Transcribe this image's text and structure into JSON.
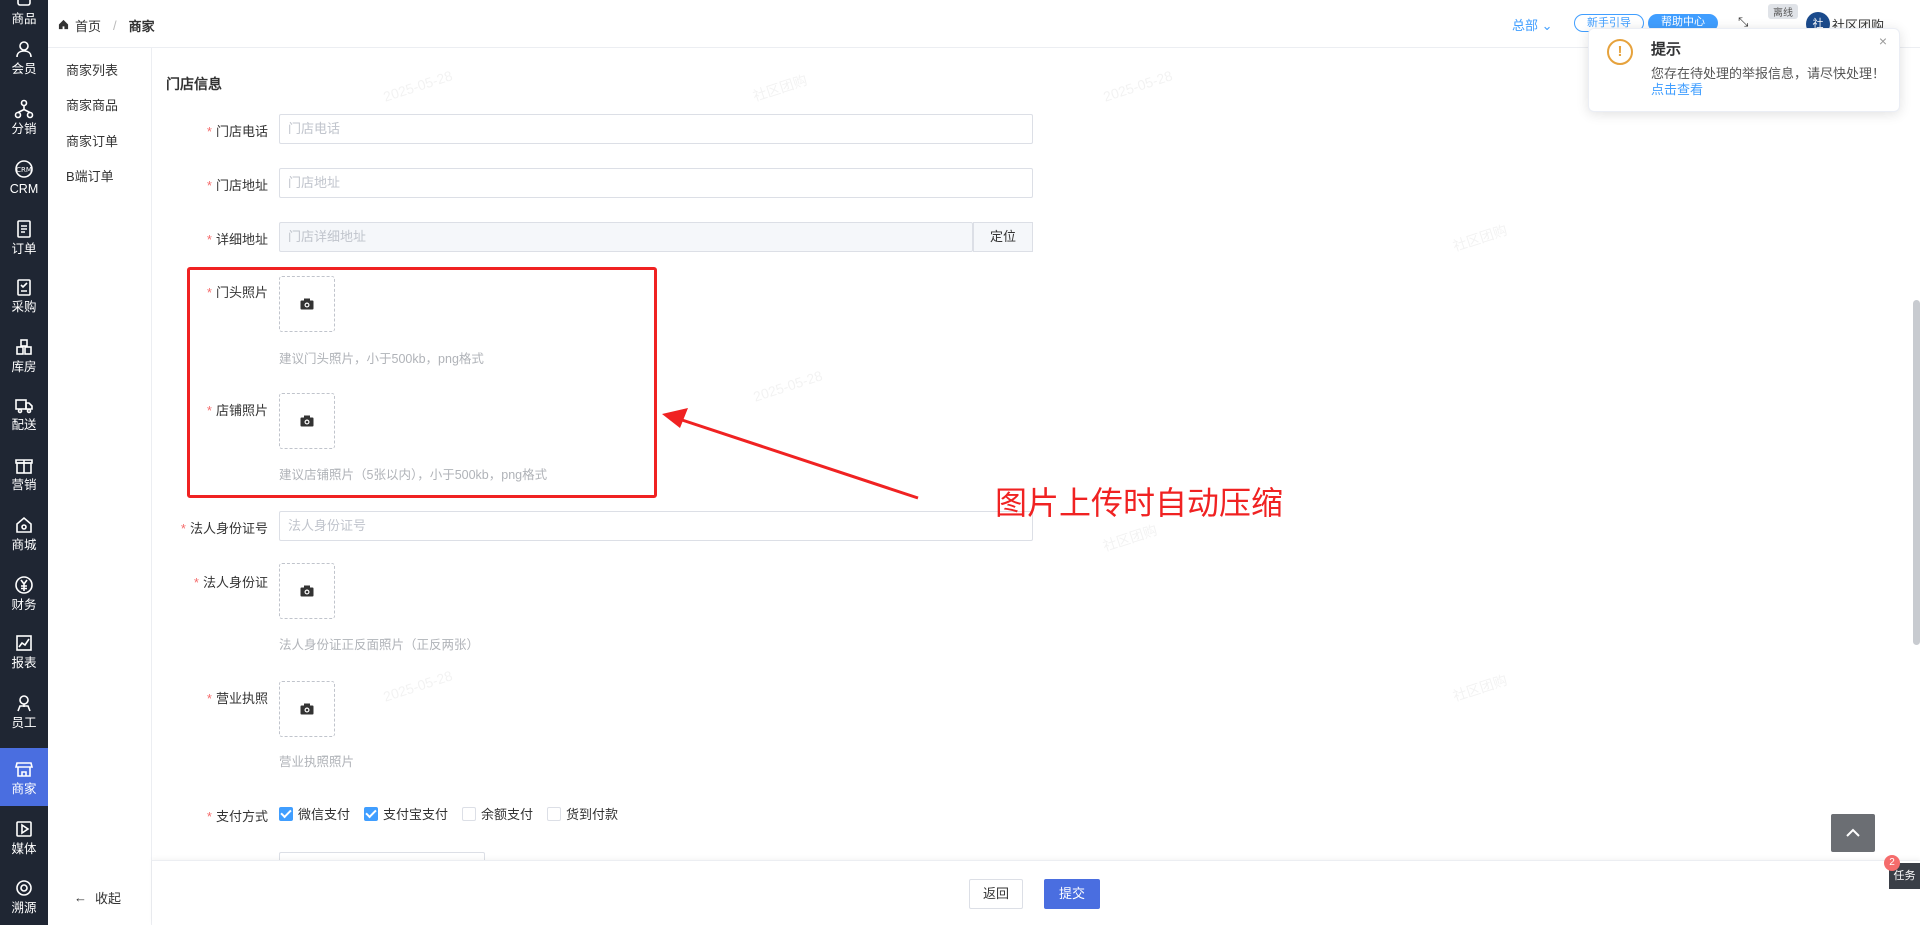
{
  "nav": {
    "items": [
      {
        "label": "商品",
        "icon": "box-icon"
      },
      {
        "label": "会员",
        "icon": "user-icon"
      },
      {
        "label": "分销",
        "icon": "network-icon"
      },
      {
        "label": "CRM",
        "icon": "crm-icon"
      },
      {
        "label": "订单",
        "icon": "order-icon"
      },
      {
        "label": "采购",
        "icon": "purchase-icon"
      },
      {
        "label": "库房",
        "icon": "warehouse-icon"
      },
      {
        "label": "配送",
        "icon": "truck-icon"
      },
      {
        "label": "营销",
        "icon": "gift-icon"
      },
      {
        "label": "商城",
        "icon": "home-icon"
      },
      {
        "label": "财务",
        "icon": "yen-icon"
      },
      {
        "label": "报表",
        "icon": "chart-icon"
      },
      {
        "label": "员工",
        "icon": "staff-icon"
      },
      {
        "label": "商家",
        "icon": "shop-icon"
      },
      {
        "label": "媒体",
        "icon": "play-icon"
      },
      {
        "label": "溯源",
        "icon": "trace-icon"
      }
    ],
    "active": "商家"
  },
  "submenu": {
    "items": [
      "商家列表",
      "商家商品",
      "商家订单",
      "B端订单"
    ],
    "collapse_label": "收起"
  },
  "header": {
    "breadcrumb_home": "首页",
    "breadcrumb_current": "商家",
    "hq_label": "总部",
    "btn_outline": "新手引导",
    "btn_solid": "帮助中心",
    "offline_tag": "离线",
    "logo_text": "社",
    "org_name": "社区团购"
  },
  "form": {
    "section_title": "门店信息",
    "store_phone": {
      "label": "门店电话",
      "placeholder": "门店电话"
    },
    "store_address": {
      "label": "门店地址",
      "placeholder": "门店地址"
    },
    "detail_address": {
      "label": "详细地址",
      "placeholder": "门店详细地址",
      "locate_btn": "定位"
    },
    "front_photo": {
      "label": "门头照片",
      "hint": "建议门头照片，小于500kb，png格式"
    },
    "shop_photo": {
      "label": "店铺照片",
      "hint": "建议店铺照片（5张以内），小于500kb，png格式"
    },
    "legal_id_no": {
      "label": "法人身份证号",
      "placeholder": "法人身份证号"
    },
    "legal_id": {
      "label": "法人身份证",
      "hint": "法人身份证正反面照片（正反两张）"
    },
    "license": {
      "label": "营业执照",
      "hint": "营业执照照片"
    },
    "payment": {
      "label": "支付方式",
      "options": [
        {
          "label": "微信支付",
          "checked": true
        },
        {
          "label": "支付宝支付",
          "checked": true
        },
        {
          "label": "余额支付",
          "checked": false
        },
        {
          "label": "货到付款",
          "checked": false
        }
      ]
    }
  },
  "annotation": {
    "text": "图片上传时自动压缩",
    "color": "#f02222"
  },
  "footer": {
    "back_label": "返回",
    "submit_label": "提交"
  },
  "notice": {
    "icon": "!",
    "title": "提示",
    "message": "您存在待处理的举报信息，请尽快处理！",
    "link": "点击查看",
    "close": "×"
  },
  "task": {
    "label": "任务",
    "badge": "2"
  },
  "watermark": {
    "date": "2025-05-28",
    "brand": "社区团购"
  },
  "colors": {
    "primary": "#409eff",
    "accent": "#4a6ee0",
    "nav_bg": "#1f2633",
    "required": "#f56c6c"
  }
}
